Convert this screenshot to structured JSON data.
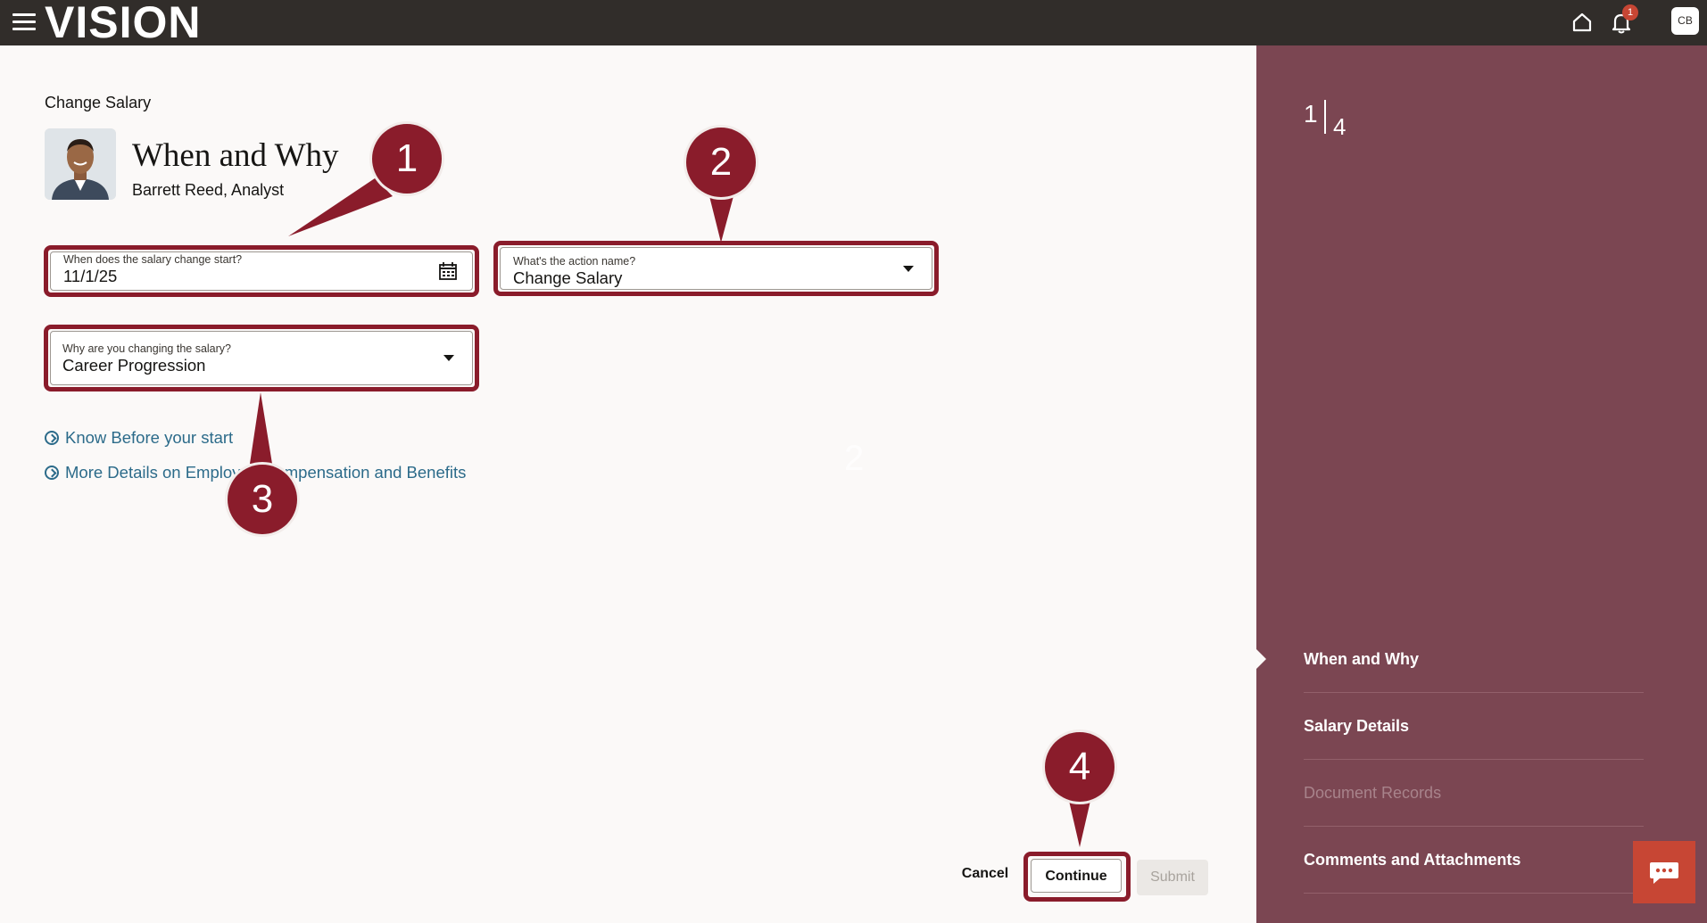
{
  "topbar": {
    "logo": "VISION",
    "notification_count": "1",
    "user_initials": "CB"
  },
  "page": {
    "breadcrumb": "Change Salary",
    "title": "When and Why",
    "person": "Barrett Reed, Analyst"
  },
  "form": {
    "start_date": {
      "label": "When does the salary change start?",
      "value": "11/1/25"
    },
    "action_name": {
      "label": "What's the action name?",
      "value": "Change Salary"
    },
    "reason": {
      "label": "Why are you changing the salary?",
      "value": "Career Progression"
    }
  },
  "links": [
    {
      "label": "Know Before your start"
    },
    {
      "label": "More Details on Employee Compensation and Benefits"
    }
  ],
  "callouts": [
    "1",
    "2",
    "3",
    "4"
  ],
  "stray_number": "2",
  "buttons": {
    "cancel": "Cancel",
    "continue": "Continue",
    "submit": "Submit"
  },
  "progress": {
    "current": "1",
    "total": "4",
    "steps": [
      {
        "label": "When and Why",
        "state": "active"
      },
      {
        "label": "Salary Details",
        "state": "enabled"
      },
      {
        "label": "Document Records",
        "state": "disabled"
      },
      {
        "label": "Comments and Attachments",
        "state": "enabled"
      }
    ]
  },
  "colors": {
    "topbar": "#312d2a",
    "panel": "#7b4652",
    "callout": "#8a1c2b",
    "link": "#2c6b8a",
    "chat": "#c74634"
  }
}
